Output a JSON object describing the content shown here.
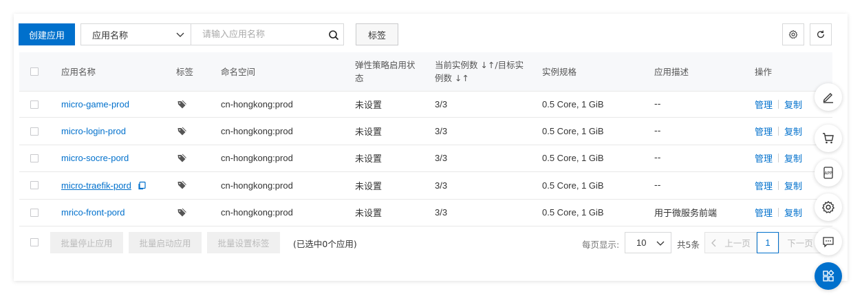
{
  "toolbar": {
    "create_label": "创建应用",
    "filter_select": "应用名称",
    "search_placeholder": "请输入应用名称",
    "tag_label": "标签"
  },
  "table": {
    "headers": {
      "name": "应用名称",
      "tag": "标签",
      "namespace": "命名空间",
      "autoscale_line1": "弹性策略启用状",
      "autoscale_line2": "态",
      "instances_line1": "当前实例数 ↓↑/目标实",
      "instances_line2": "例数 ↓↑",
      "spec": "实例规格",
      "desc": "应用描述",
      "ops": "操作"
    },
    "rows": [
      {
        "name": "micro-game-prod",
        "namespace": "cn-hongkong:prod",
        "autoscale": "未设置",
        "instances": "3/3",
        "spec": "0.5 Core, 1 GiB",
        "desc": "--",
        "manage": "管理",
        "copy": "复制"
      },
      {
        "name": "micro-login-prod",
        "namespace": "cn-hongkong:prod",
        "autoscale": "未设置",
        "instances": "3/3",
        "spec": "0.5 Core, 1 GiB",
        "desc": "--",
        "manage": "管理",
        "copy": "复制"
      },
      {
        "name": "micro-socre-pord",
        "namespace": "cn-hongkong:prod",
        "autoscale": "未设置",
        "instances": "3/3",
        "spec": "0.5 Core, 1 GiB",
        "desc": "--",
        "manage": "管理",
        "copy": "复制"
      },
      {
        "name": "micro-traefik-pord",
        "namespace": "cn-hongkong:prod",
        "autoscale": "未设置",
        "instances": "3/3",
        "spec": "0.5 Core, 1 GiB",
        "desc": "--",
        "manage": "管理",
        "copy": "复制"
      },
      {
        "name": "mrico-front-pord",
        "namespace": "cn-hongkong:prod",
        "autoscale": "未设置",
        "instances": "3/3",
        "spec": "0.5 Core, 1 GiB",
        "desc": "用于微服务前端",
        "manage": "管理",
        "copy": "复制"
      }
    ]
  },
  "footer": {
    "batch_stop": "批量停止应用",
    "batch_start": "批量启动应用",
    "batch_tag": "批量设置标签",
    "selected_text": "(已选中0个应用)",
    "page_size_label": "每页显示:",
    "page_size": "10",
    "total": "共5条",
    "prev": "上一页",
    "current_page": "1",
    "next": "下一页"
  },
  "colors": {
    "primary": "#0070cc",
    "border": "#d7d8d9",
    "header_bg": "#f7f8fa"
  },
  "icons": [
    "chevron-down-icon",
    "search-icon",
    "settings-icon",
    "refresh-icon",
    "tag-icon",
    "copy-icon",
    "edit-icon",
    "cart-icon",
    "app-icon",
    "gear-icon",
    "chat-icon",
    "grid-icon"
  ]
}
